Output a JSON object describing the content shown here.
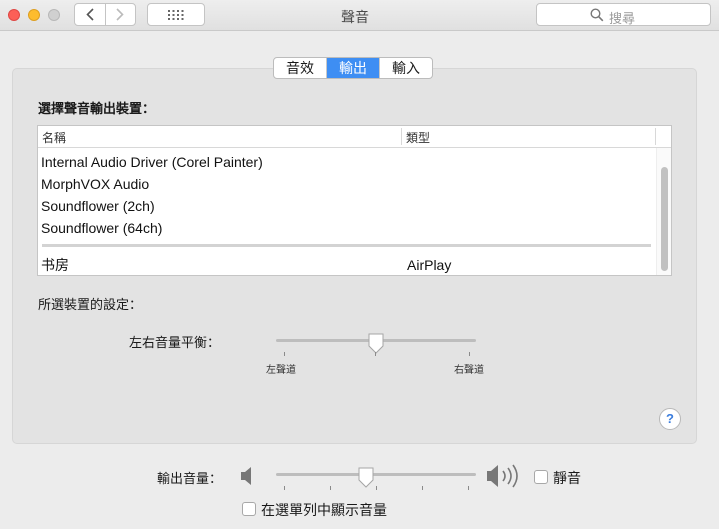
{
  "window": {
    "title": "聲音",
    "search_placeholder": "搜尋",
    "traffic_lights": [
      "close",
      "minimize",
      "zoom-disabled"
    ],
    "nav_icons": [
      "chevron-left-icon",
      "chevron-right-icon",
      "grid-icon"
    ]
  },
  "tabs": [
    {
      "label": "音效",
      "active": false
    },
    {
      "label": "輸出",
      "active": true
    },
    {
      "label": "輸入",
      "active": false
    }
  ],
  "output": {
    "section_title": "選擇聲音輸出裝置：",
    "columns": {
      "name": "名稱",
      "type": "類型"
    },
    "devices": [
      {
        "name": "Internal Audio Driver (Corel Painter)",
        "type": ""
      },
      {
        "name": "MorphVOX Audio",
        "type": ""
      },
      {
        "name": "Soundflower (2ch)",
        "type": ""
      },
      {
        "name": "Soundflower (64ch)",
        "type": ""
      }
    ],
    "other_devices": [
      {
        "name": "书房",
        "type": "AirPlay"
      }
    ],
    "settings_title": "所選裝置的設定：",
    "balance": {
      "label": "左右音量平衡：",
      "left_label": "左聲道",
      "right_label": "右聲道",
      "value": 0.5
    }
  },
  "volume": {
    "label": "輸出音量：",
    "value": 0.45,
    "mute_label": "靜音",
    "mute_checked": false,
    "show_in_menubar_label": "在選單列中顯示音量",
    "show_in_menubar_checked": false
  },
  "help_label": "?",
  "colors": {
    "accent": "#3e8ef3",
    "close": "#fc5f57",
    "minimize": "#fdbc2e"
  }
}
